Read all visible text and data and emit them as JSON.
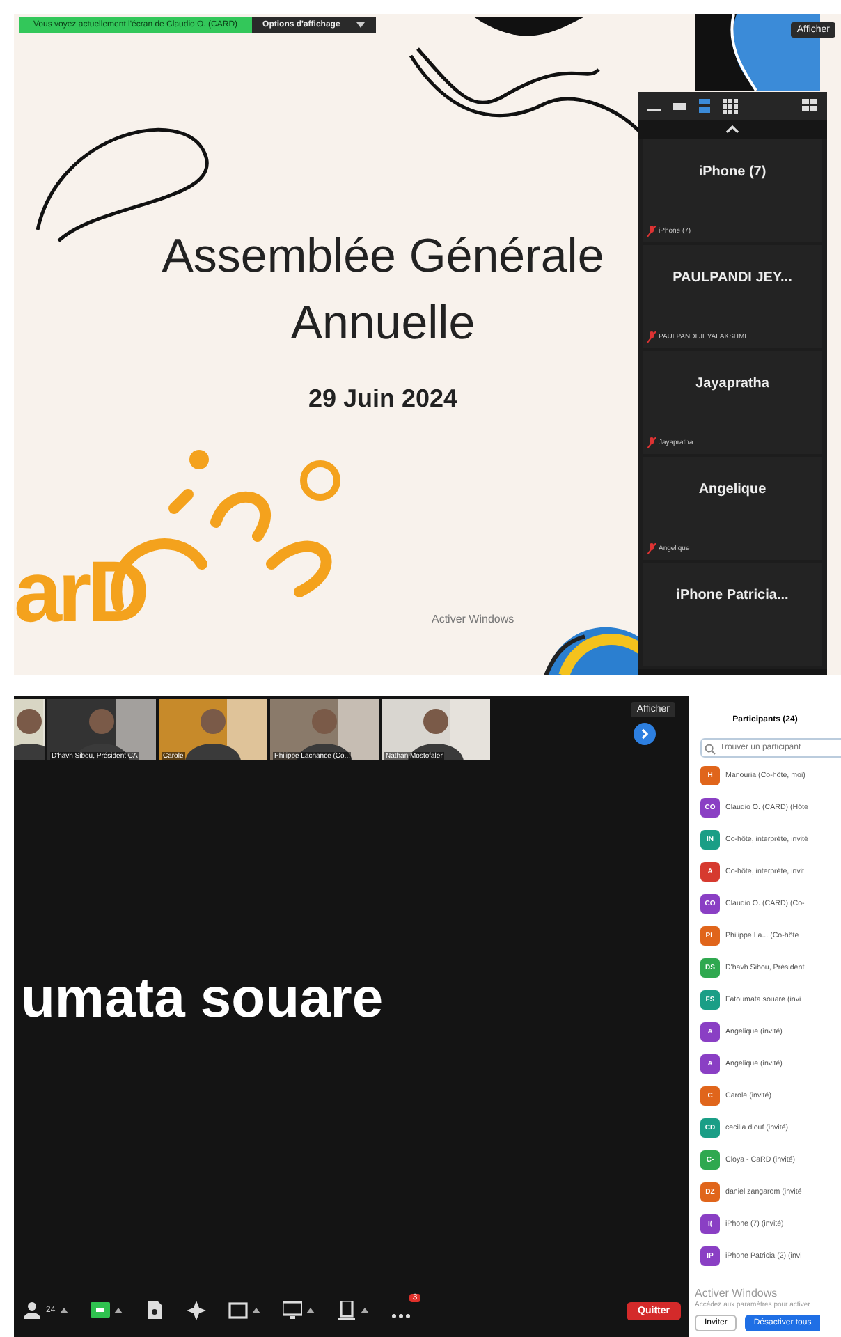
{
  "top_shot": {
    "share_banner": {
      "text": "Vous voyez actuellement l'écran de Claudio O. (CARD)",
      "options": "Options d'affichage"
    },
    "show_button": "Afficher",
    "slide": {
      "title_lines": [
        "Assemblée Générale",
        "Annuelle"
      ],
      "date": "29 Juin 2024",
      "logo": "arD"
    },
    "view_modes": [
      {
        "selected": false
      },
      {
        "selected": false
      },
      {
        "selected": true
      },
      {
        "selected": false
      }
    ],
    "gallery": [
      {
        "name": "iPhone (7)",
        "label": "iPhone (7)"
      },
      {
        "name": "PAULPANDI JEY...",
        "label": "PAULPANDI JEYALAKSHMI"
      },
      {
        "name": "Jayapratha",
        "label": "Jayapratha"
      },
      {
        "name": "Angelique",
        "label": "Angelique"
      },
      {
        "name": "iPhone  Patricia..."
      }
    ],
    "os_notice": "Activer Windows"
  },
  "bottom_shot": {
    "show_button": "Afficher",
    "thumbnails": [
      {
        "kind": "picture"
      },
      {
        "name": "D'havh Sibou, Président CA"
      },
      {
        "name": "Carole"
      },
      {
        "name": "Philippe Lachance (Co..."
      },
      {
        "name": "Nathan Mostofaler"
      }
    ],
    "speaker_name": "umata souare",
    "toolbar": [
      {
        "kind": "participants",
        "label": "24",
        "caret": true
      },
      {
        "kind": "video",
        "caret": true
      },
      {
        "kind": "notes",
        "caret": false
      },
      {
        "kind": "sparkle",
        "caret": false
      },
      {
        "kind": "frame",
        "caret": true
      },
      {
        "kind": "share",
        "caret": true
      },
      {
        "kind": "record",
        "caret": true
      },
      {
        "kind": "more",
        "badge": "3",
        "caret": false
      }
    ],
    "leave_button": "Quitter",
    "participants": {
      "title": "Participants (24)",
      "search_placeholder": "Trouver un participant",
      "items": [
        {
          "initials": "H",
          "name": "Manouria (Co-hôte, moi)",
          "color": "#e0651b"
        },
        {
          "initials": "CO",
          "name": "Claudio O. (CARD) (Hôte",
          "color": "#8a3fc4"
        },
        {
          "initials": "IN",
          "name": "Co-hôte, interprète, invité",
          "color": "#1a9e86"
        },
        {
          "initials": "A",
          "name": "Co-hôte, interprète, invit",
          "color": "#d63a2f"
        },
        {
          "initials": "CO",
          "name": "Claudio O. (CARD) (Co-",
          "color": "#8a3fc4"
        },
        {
          "initials": "PL",
          "name": "Philippe La... (Co-hôte",
          "color": "#e0651b"
        },
        {
          "initials": "DS",
          "name": "D'havh Sibou, Président",
          "color": "#2fa84f"
        },
        {
          "initials": "FS",
          "name": "Fatoumata souare (invi",
          "color": "#1a9e86"
        },
        {
          "initials": "A",
          "name": "Angelique (invité)",
          "color": "#8a3fc4"
        },
        {
          "initials": "A",
          "name": "Angelique (invité)",
          "color": "#8a3fc4"
        },
        {
          "initials": "C",
          "name": "Carole (invité)",
          "color": "#e0651b"
        },
        {
          "initials": "CD",
          "name": "cecilia diouf (invité)",
          "color": "#1a9e86"
        },
        {
          "initials": "C-",
          "name": "Cloya - CaRD (invité)",
          "color": "#2fa84f"
        },
        {
          "initials": "DZ",
          "name": "daniel zangarom (invité",
          "color": "#e0651b"
        },
        {
          "initials": "I(",
          "name": "iPhone (7) (invité)",
          "color": "#8a3fc4"
        },
        {
          "initials": "IP",
          "name": "iPhone Patricia (2) (invi",
          "color": "#8a3fc4"
        }
      ],
      "os_notice": "Activer Windows",
      "os_hint": "Accédez aux paramètres pour activer",
      "invite_button": "Inviter",
      "mute_all_button": "Désactiver tous"
    }
  }
}
